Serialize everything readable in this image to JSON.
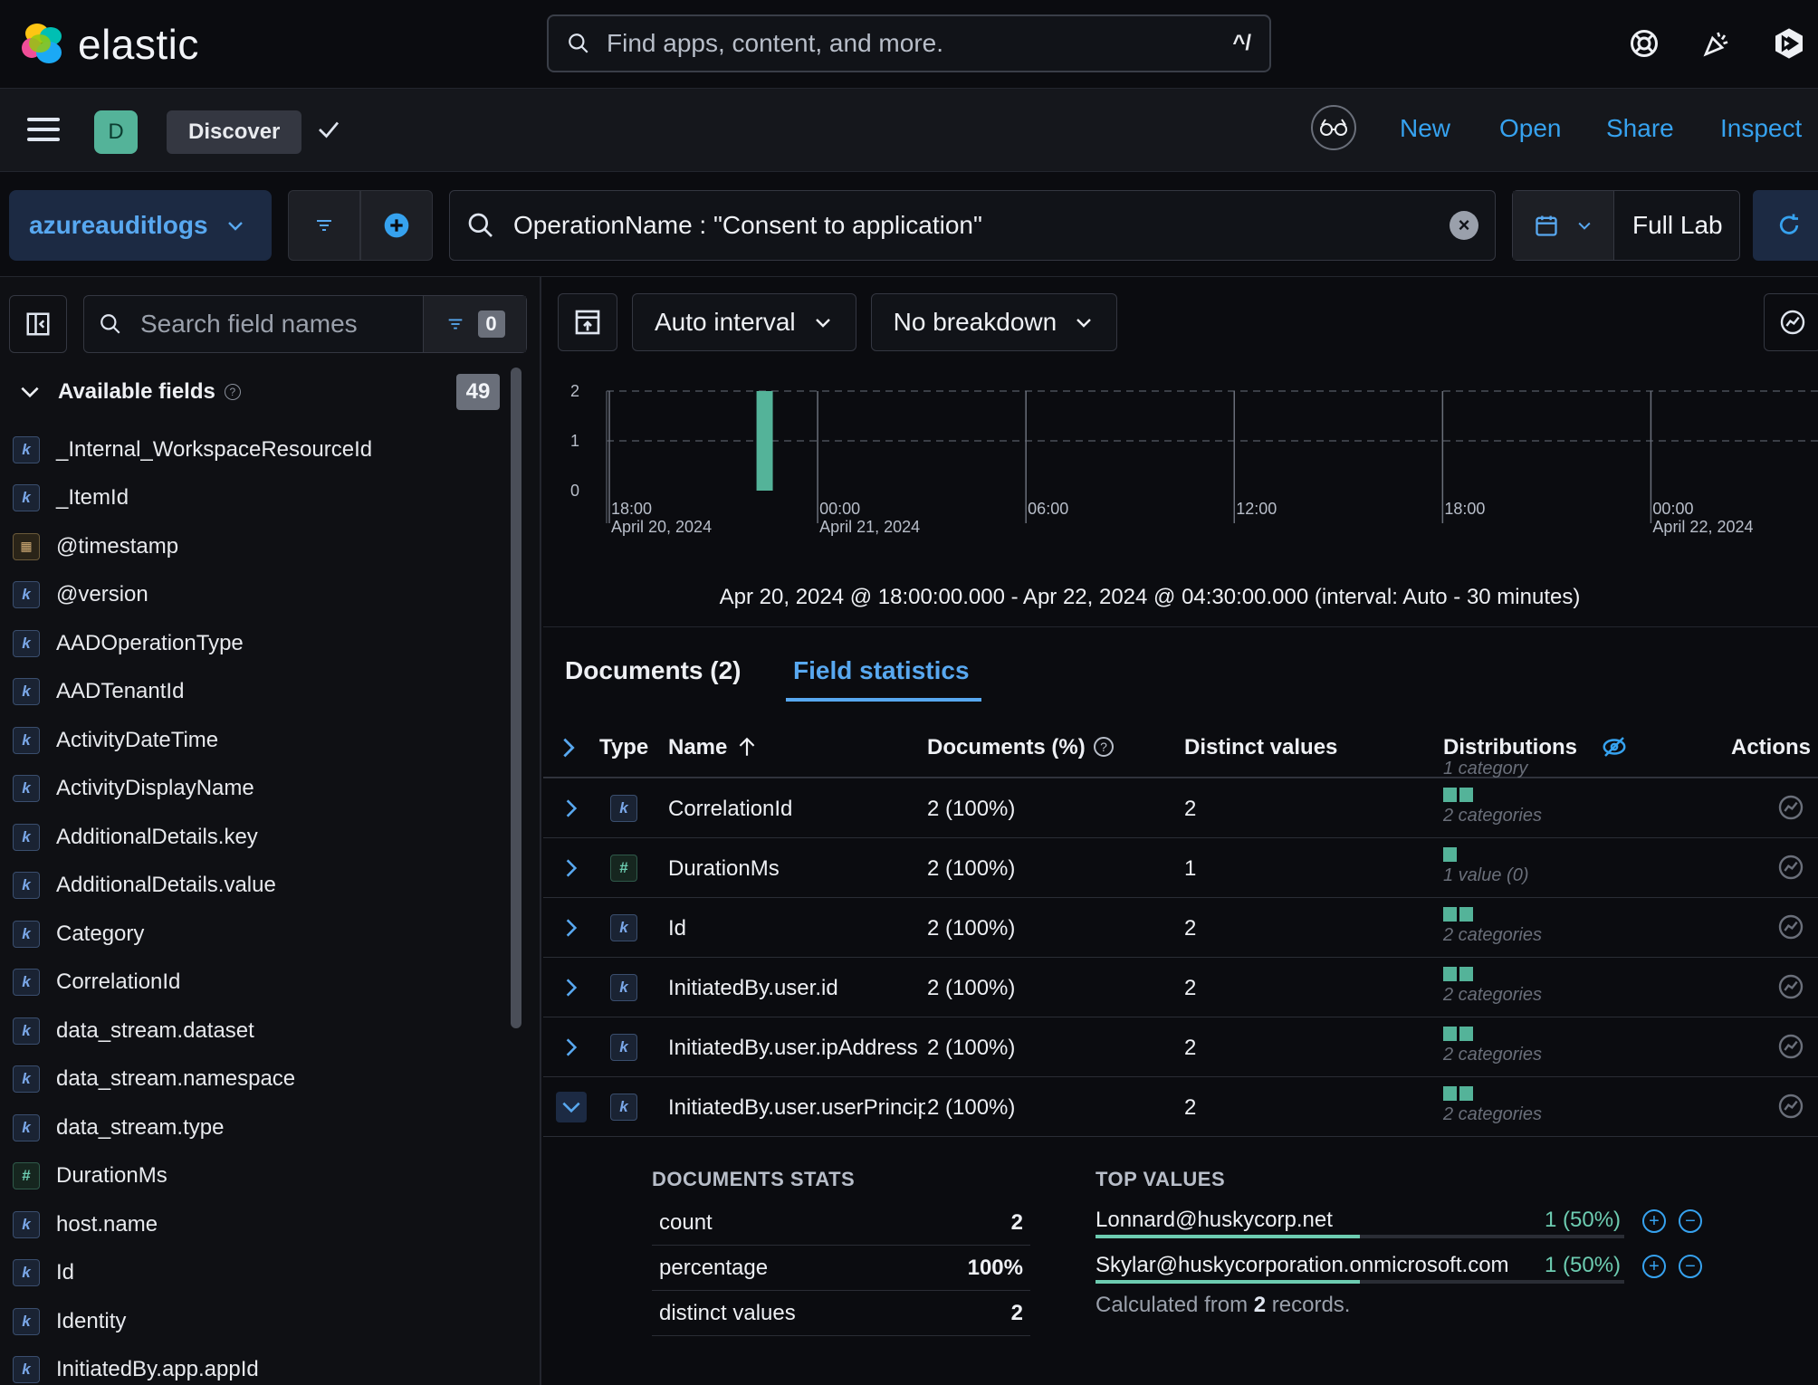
{
  "header": {
    "brand": "elastic",
    "search_placeholder": "Find apps, content, and more.",
    "shortcut": "^/"
  },
  "nav": {
    "avatar_letter": "D",
    "breadcrumb": "Discover",
    "links": {
      "new": "New",
      "open": "Open",
      "share": "Share",
      "inspect": "Inspect"
    }
  },
  "query": {
    "data_view": "azureauditlogs",
    "text": "OperationName : \"Consent to application\"",
    "date_label": "Full Lab"
  },
  "sidebar": {
    "search_placeholder": "Search field names",
    "filter_count": "0",
    "available_title": "Available fields",
    "available_count": "49",
    "fields": [
      {
        "type": "k",
        "name": "_Internal_WorkspaceResourceId"
      },
      {
        "type": "k",
        "name": "_ItemId"
      },
      {
        "type": "date",
        "name": "@timestamp"
      },
      {
        "type": "k",
        "name": "@version"
      },
      {
        "type": "k",
        "name": "AADOperationType"
      },
      {
        "type": "k",
        "name": "AADTenantId"
      },
      {
        "type": "k",
        "name": "ActivityDateTime"
      },
      {
        "type": "k",
        "name": "ActivityDisplayName"
      },
      {
        "type": "k",
        "name": "AdditionalDetails.key"
      },
      {
        "type": "k",
        "name": "AdditionalDetails.value"
      },
      {
        "type": "k",
        "name": "Category"
      },
      {
        "type": "k",
        "name": "CorrelationId"
      },
      {
        "type": "k",
        "name": "data_stream.dataset"
      },
      {
        "type": "k",
        "name": "data_stream.namespace"
      },
      {
        "type": "k",
        "name": "data_stream.type"
      },
      {
        "type": "#",
        "name": "DurationMs"
      },
      {
        "type": "k",
        "name": "host.name"
      },
      {
        "type": "k",
        "name": "Id"
      },
      {
        "type": "k",
        "name": "Identity"
      },
      {
        "type": "k",
        "name": "InitiatedBy.app.appId"
      }
    ]
  },
  "chart_controls": {
    "interval": "Auto interval",
    "breakdown": "No breakdown"
  },
  "chart_data": {
    "type": "bar",
    "y_ticks": [
      "2",
      "1",
      "0"
    ],
    "ylim": [
      0,
      2
    ],
    "x_ticks": [
      {
        "time": "18:00",
        "date": "April 20, 2024"
      },
      {
        "time": "00:00",
        "date": "April 21, 2024"
      },
      {
        "time": "06:00",
        "date": ""
      },
      {
        "time": "12:00",
        "date": ""
      },
      {
        "time": "18:00",
        "date": ""
      },
      {
        "time": "00:00",
        "date": "April 22, 2024"
      }
    ],
    "bars": [
      {
        "x": "Apr 20, 2024 @ 22:30",
        "value": 2
      }
    ],
    "range_text": "Apr 20, 2024 @ 18:00:00.000 - Apr 22, 2024 @ 04:30:00.000 (interval: Auto - 30 minutes)"
  },
  "tabs": {
    "documents": "Documents (2)",
    "field_stats": "Field statistics"
  },
  "table": {
    "headers": {
      "type": "Type",
      "name": "Name",
      "docs": "Documents (%)",
      "distinct": "Distinct values",
      "dist": "Distributions",
      "actions": "Actions"
    },
    "partial_label": "1 category",
    "rows": [
      {
        "type": "k",
        "name": "CorrelationId",
        "docs": "2 (100%)",
        "distinct": "2",
        "bars": 2,
        "dist_label": "2 categories"
      },
      {
        "type": "#",
        "name": "DurationMs",
        "docs": "2 (100%)",
        "distinct": "1",
        "bars": 1,
        "dist_label": "1 value (0)"
      },
      {
        "type": "k",
        "name": "Id",
        "docs": "2 (100%)",
        "distinct": "2",
        "bars": 2,
        "dist_label": "2 categories"
      },
      {
        "type": "k",
        "name": "InitiatedBy.user.id",
        "docs": "2 (100%)",
        "distinct": "2",
        "bars": 2,
        "dist_label": "2 categories"
      },
      {
        "type": "k",
        "name": "InitiatedBy.user.ipAddress",
        "docs": "2 (100%)",
        "distinct": "2",
        "bars": 2,
        "dist_label": "2 categories"
      },
      {
        "type": "k",
        "name": "InitiatedBy.user.userPrincipalName",
        "docs": "2 (100%)",
        "distinct": "2",
        "bars": 2,
        "dist_label": "2 categories"
      }
    ]
  },
  "expanded": {
    "docs_stats_title": "DOCUMENTS STATS",
    "stats": [
      {
        "label": "count",
        "value": "2"
      },
      {
        "label": "percentage",
        "value": "100%"
      },
      {
        "label": "distinct values",
        "value": "2"
      }
    ],
    "top_values_title": "TOP VALUES",
    "top_values": [
      {
        "value": "Lonnard@huskycorp.net",
        "pct": "1 (50%)",
        "fraction": 0.5
      },
      {
        "value": "Skylar@huskycorporation.onmicrosoft.com",
        "pct": "1 (50%)",
        "fraction": 0.5
      }
    ],
    "calc_prefix": "Calculated from ",
    "calc_count": "2",
    "calc_suffix": " records."
  },
  "colors": {
    "accent": "#36a2ef",
    "bar": "#54b399",
    "background": "#0b0c10"
  }
}
